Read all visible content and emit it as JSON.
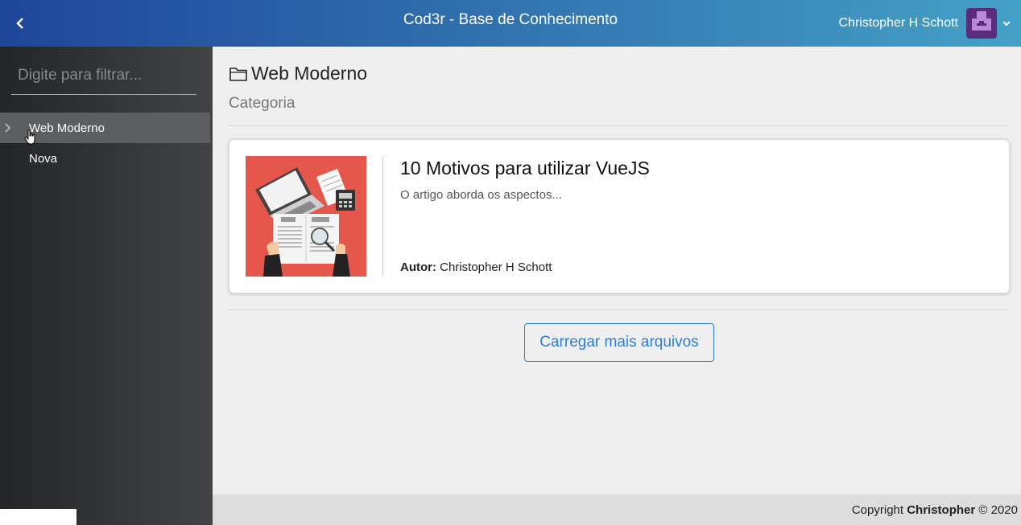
{
  "header": {
    "title": "Cod3r - Base de Conhecimento",
    "toggle_icon": "chevron-left-icon",
    "user_name": "Christopher H Schott",
    "dropdown_icon": "chevron-down-icon"
  },
  "sidebar": {
    "search_placeholder": "Digite para filtrar...",
    "items": [
      {
        "label": "Web Moderno",
        "selected": true,
        "has_children": true
      },
      {
        "label": "Nova",
        "selected": false,
        "has_children": false
      }
    ]
  },
  "main": {
    "title": "Web Moderno",
    "subtitle": "Categoria",
    "articles": [
      {
        "title": "10 Motivos para utilizar VueJS",
        "description": "O artigo aborda os aspectos...",
        "author_label": "Autor:",
        "author_name": "Christopher H Schott"
      }
    ],
    "load_more_label": "Carregar mais arquivos"
  },
  "footer": {
    "copyright_label": "Copyright",
    "owner": "Christopher",
    "year_text": "© 2020"
  },
  "colors": {
    "header_gradient_start": "#1e469a",
    "header_gradient_end": "#44a1c6",
    "sidebar_dark": "#232526",
    "sidebar_light": "#414345",
    "accent_blue": "#2a7fd8",
    "image_background": "#e5574a"
  }
}
